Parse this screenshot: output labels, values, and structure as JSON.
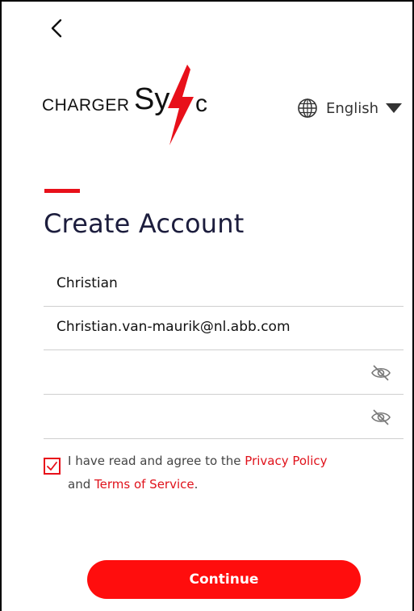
{
  "colors": {
    "accent": "#e8101a",
    "button": "#ff0d0d",
    "title": "#1c1d3d"
  },
  "header": {
    "back_icon": "chevron-left-icon",
    "logo": {
      "part1": "CHARGER",
      "part2": "Sy",
      "part3": "c"
    },
    "language": {
      "icon": "globe-icon",
      "label": "English",
      "caret_icon": "caret-down-icon"
    }
  },
  "form": {
    "title": "Create Account",
    "fields": [
      {
        "value": "Christian"
      },
      {
        "value": "Christian.van-maurik@nl.abb.com"
      },
      {
        "value": "",
        "icon": "eye-off-icon"
      },
      {
        "value": "",
        "icon": "eye-off-icon"
      }
    ],
    "consent": {
      "checked": true,
      "text_before": "I have read and agree to the ",
      "privacy_link": "Privacy Policy",
      "text_and": "and ",
      "terms_link": "Terms of Service",
      "text_end": "."
    },
    "continue_label": "Continue"
  }
}
